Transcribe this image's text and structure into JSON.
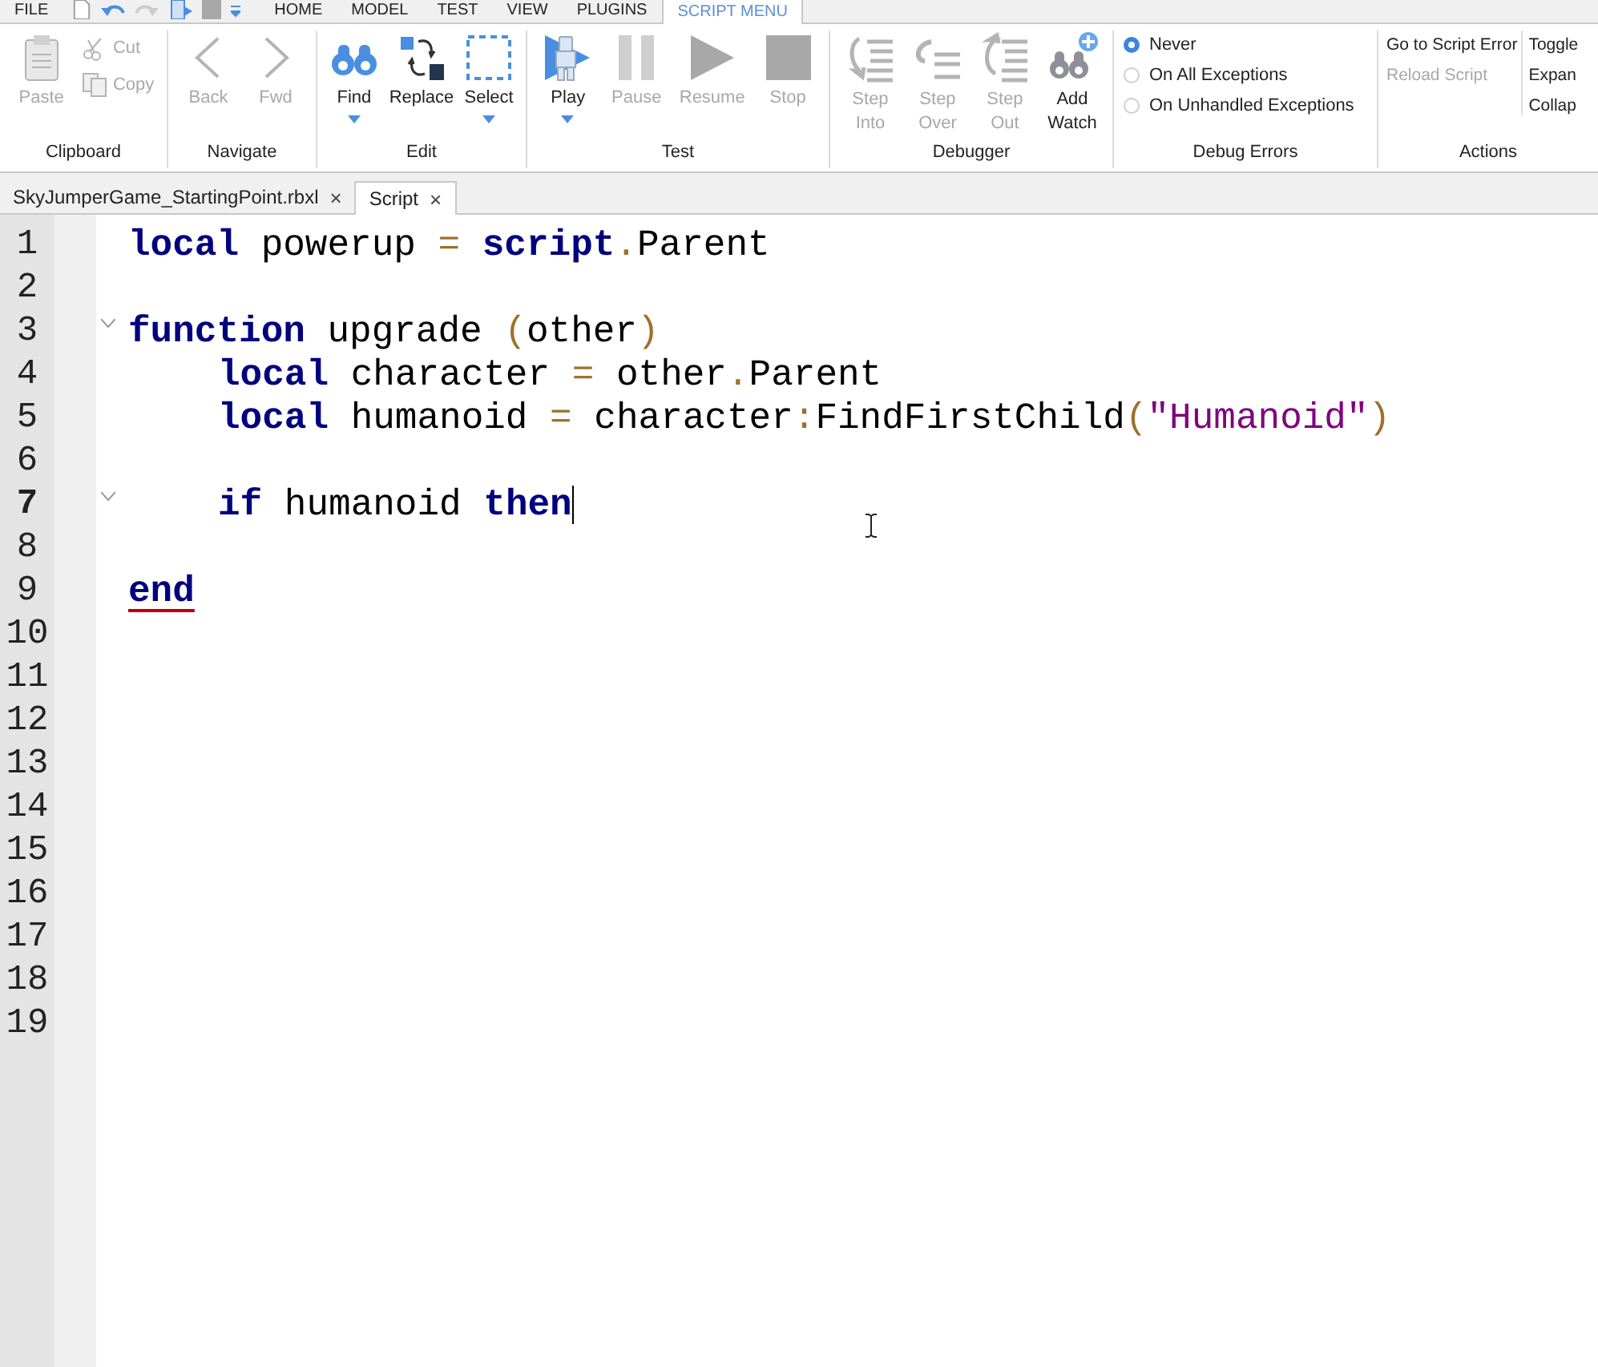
{
  "menu_bar": {
    "tabs": [
      {
        "label": "FILE",
        "selected": false
      },
      {
        "label": "HOME",
        "selected": false
      },
      {
        "label": "MODEL",
        "selected": false
      },
      {
        "label": "TEST",
        "selected": false
      },
      {
        "label": "VIEW",
        "selected": false
      },
      {
        "label": "PLUGINS",
        "selected": false
      },
      {
        "label": "SCRIPT MENU",
        "selected": true
      }
    ]
  },
  "ribbon": {
    "groups": [
      {
        "label": "Clipboard",
        "buttons": [
          {
            "kind": "large",
            "label": "Paste",
            "disabled": true,
            "dropdown": false
          },
          {
            "kind": "stack",
            "items": [
              {
                "label": "Cut",
                "disabled": true
              },
              {
                "label": "Copy",
                "disabled": true
              }
            ]
          }
        ]
      },
      {
        "label": "Navigate",
        "buttons": [
          {
            "kind": "large",
            "label": "Back",
            "disabled": true,
            "dropdown": false
          },
          {
            "kind": "large",
            "label": "Fwd",
            "disabled": true,
            "dropdown": false
          }
        ]
      },
      {
        "label": "Edit",
        "buttons": [
          {
            "kind": "large",
            "label": "Find",
            "disabled": false,
            "dropdown": true
          },
          {
            "kind": "large",
            "label": "Replace",
            "disabled": false,
            "dropdown": false
          },
          {
            "kind": "large",
            "label": "Select",
            "disabled": false,
            "dropdown": true
          }
        ]
      },
      {
        "label": "Test",
        "buttons": [
          {
            "kind": "large",
            "label": "Play",
            "disabled": false,
            "dropdown": true
          },
          {
            "kind": "large",
            "label": "Pause",
            "disabled": true,
            "dropdown": false
          },
          {
            "kind": "large",
            "label": "Resume",
            "disabled": true,
            "dropdown": false
          },
          {
            "kind": "large",
            "label": "Stop",
            "disabled": true,
            "dropdown": false
          }
        ]
      },
      {
        "label": "Debugger",
        "buttons": [
          {
            "kind": "large",
            "label": "Step Into",
            "disabled": true,
            "dropdown": false
          },
          {
            "kind": "large",
            "label": "Step Over",
            "disabled": true,
            "dropdown": false
          },
          {
            "kind": "large",
            "label": "Step Out",
            "disabled": true,
            "dropdown": false
          },
          {
            "kind": "large",
            "label": "Add Watch",
            "disabled": false,
            "dropdown": false
          }
        ]
      },
      {
        "label": "Debug Errors",
        "buttons": [
          {
            "kind": "radios",
            "items": [
              {
                "label": "Never",
                "selected": true
              },
              {
                "label": "On All Exceptions",
                "selected": false
              },
              {
                "label": "On Unhandled Exceptions",
                "selected": false
              }
            ]
          }
        ]
      },
      {
        "label": "Actions",
        "buttons": [
          {
            "kind": "stack",
            "items": [
              {
                "label": "Go to Script Error",
                "disabled": false
              },
              {
                "label": "Reload Script",
                "disabled": true
              }
            ]
          },
          {
            "kind": "stack",
            "items": [
              {
                "label": "Toggle",
                "disabled": false
              },
              {
                "label": "Expan",
                "disabled": false
              },
              {
                "label": "Collap",
                "disabled": false
              }
            ]
          }
        ]
      }
    ]
  },
  "document_tabs": [
    {
      "label": "SkyJumperGame_StartingPoint.rbxl",
      "close": "×",
      "selected": false
    },
    {
      "label": "Script",
      "close": "×",
      "selected": true
    }
  ],
  "editor": {
    "lines": [
      {
        "number": "1",
        "current": false,
        "fold": false,
        "indented": false,
        "caret": false,
        "tokens": [
          {
            "text": "local",
            "kind": "keyword"
          },
          {
            "text": " powerup ",
            "kind": "plain"
          },
          {
            "text": "= ",
            "kind": "operator"
          },
          {
            "text": "script",
            "kind": "keyword"
          },
          {
            "text": ".",
            "kind": "operator"
          },
          {
            "text": "Parent",
            "kind": "plain"
          }
        ]
      },
      {
        "number": "2",
        "current": false,
        "fold": false,
        "caret": false
      },
      {
        "number": "3",
        "current": false,
        "fold": true,
        "indented": false,
        "caret": false,
        "tokens": [
          {
            "text": "function",
            "kind": "keyword"
          },
          {
            "text": " upgrade ",
            "kind": "plain"
          },
          {
            "text": "(",
            "kind": "operator"
          },
          {
            "text": "other",
            "kind": "plain"
          },
          {
            "text": ")",
            "kind": "operator"
          }
        ]
      },
      {
        "number": "4",
        "current": false,
        "fold": false,
        "indented": true,
        "caret": false,
        "tokens": [
          {
            "text": "local",
            "kind": "keyword"
          },
          {
            "text": " character ",
            "kind": "plain"
          },
          {
            "text": "=",
            "kind": "operator"
          },
          {
            "text": " other",
            "kind": "plain"
          },
          {
            "text": ".",
            "kind": "operator"
          },
          {
            "text": "Parent",
            "kind": "plain"
          }
        ]
      },
      {
        "number": "5",
        "current": false,
        "fold": false,
        "indented": true,
        "caret": false,
        "tokens": [
          {
            "text": "local",
            "kind": "keyword"
          },
          {
            "text": " humanoid ",
            "kind": "plain"
          },
          {
            "text": "=",
            "kind": "operator"
          },
          {
            "text": " character",
            "kind": "plain"
          },
          {
            "text": ":",
            "kind": "operator"
          },
          {
            "text": "FindFirstChild",
            "kind": "plain"
          },
          {
            "text": "(",
            "kind": "operator"
          },
          {
            "text": "\"Humanoid\"",
            "kind": "string"
          },
          {
            "text": ")",
            "kind": "operator"
          }
        ]
      },
      {
        "number": "6",
        "current": false,
        "fold": false,
        "caret": false
      },
      {
        "number": "7",
        "current": true,
        "fold": true,
        "indented": true,
        "caret": true,
        "tokens": [
          {
            "text": "if",
            "kind": "keyword"
          },
          {
            "text": " humanoid ",
            "kind": "plain"
          },
          {
            "text": "then",
            "kind": "keyword"
          }
        ]
      },
      {
        "number": "8",
        "current": false,
        "fold": false,
        "caret": false
      },
      {
        "number": "9",
        "current": false,
        "fold": false,
        "indented": false,
        "caret": false,
        "tokens": [
          {
            "text": "end",
            "kind": "keyword",
            "error": true
          }
        ]
      },
      {
        "number": "10",
        "current": false,
        "fold": false,
        "caret": false
      },
      {
        "number": "11",
        "current": false,
        "fold": false,
        "caret": false
      },
      {
        "number": "12",
        "current": false,
        "fold": false,
        "caret": false
      },
      {
        "number": "13",
        "current": false,
        "fold": false,
        "caret": false
      },
      {
        "number": "14",
        "current": false,
        "fold": false,
        "caret": false
      },
      {
        "number": "15",
        "current": false,
        "fold": false,
        "caret": false
      },
      {
        "number": "16",
        "current": false,
        "fold": false,
        "caret": false
      },
      {
        "number": "17",
        "current": false,
        "fold": false,
        "caret": false
      },
      {
        "number": "18",
        "current": false,
        "fold": false,
        "caret": false
      },
      {
        "number": "19",
        "current": false,
        "fold": false,
        "caret": false
      }
    ]
  }
}
